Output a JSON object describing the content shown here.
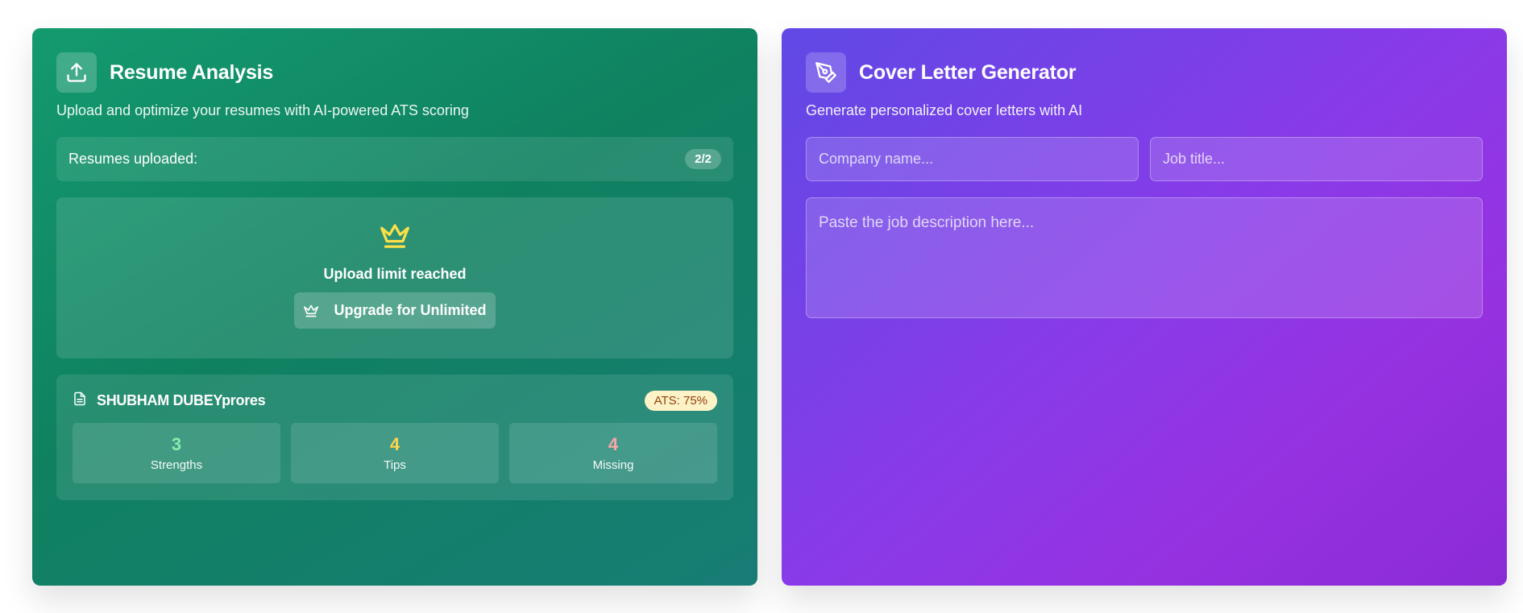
{
  "resume_card": {
    "title": "Resume Analysis",
    "subtitle": "Upload and optimize your resumes with AI-powered ATS scoring",
    "uploaded_label": "Resumes uploaded:",
    "uploaded_count": "2/2",
    "limit_text": "Upload limit reached",
    "upgrade_label": "Upgrade for Unlimited",
    "resume": {
      "name": "SHUBHAM DUBEYprores",
      "ats": "ATS: 75%",
      "stats": [
        {
          "value": "3",
          "label": "Strengths",
          "color": "#86efac"
        },
        {
          "value": "4",
          "label": "Tips",
          "color": "#fcd34d"
        },
        {
          "value": "4",
          "label": "Missing",
          "color": "#fca5a5"
        }
      ]
    },
    "icons": {
      "header": "upload-icon",
      "limit": "crown-icon",
      "button": "crown-icon",
      "resume": "file-icon"
    },
    "colors": {
      "crown": "#fde047",
      "ats_bg": "#fef3c7",
      "ats_text": "#92400e"
    }
  },
  "cover_card": {
    "title": "Cover Letter Generator",
    "subtitle": "Generate personalized cover letters with AI",
    "company_placeholder": "Company name...",
    "job_placeholder": "Job title...",
    "description_placeholder": "Paste the job description here...",
    "icons": {
      "header": "pen-tool-icon"
    }
  }
}
